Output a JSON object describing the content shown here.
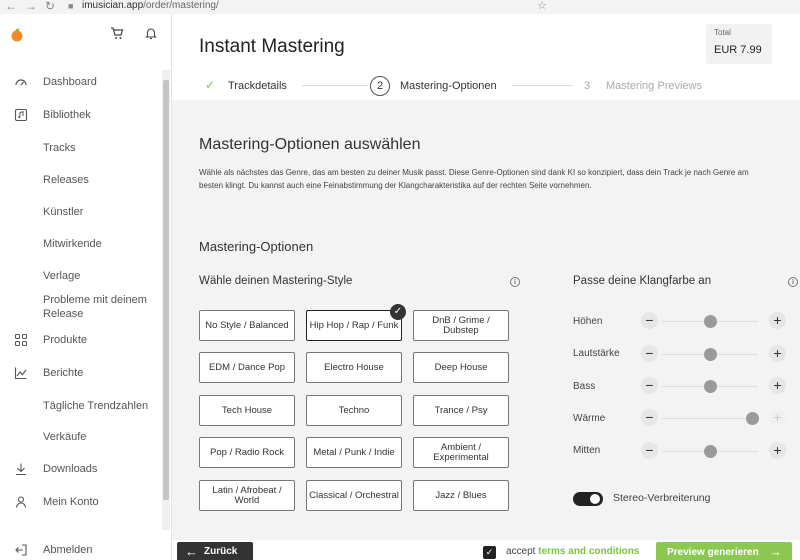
{
  "browser": {
    "url_host": "imusician.app",
    "url_path": "/order/mastering/"
  },
  "sidebar": {
    "items": [
      {
        "label": "Dashboard",
        "icon": "speedometer-icon"
      },
      {
        "label": "Bibliothek",
        "icon": "music-library-icon"
      },
      {
        "label": "Tracks"
      },
      {
        "label": "Releases"
      },
      {
        "label": "Künstler"
      },
      {
        "label": "Mitwirkende"
      },
      {
        "label": "Verlage"
      },
      {
        "label": "Probleme mit deinem Release"
      },
      {
        "label": "Produkte",
        "icon": "grid-icon"
      },
      {
        "label": "Berichte",
        "icon": "chart-line-icon"
      },
      {
        "label": "Tägliche Trendzahlen"
      },
      {
        "label": "Verkäufe"
      },
      {
        "label": "Downloads",
        "icon": "download-icon"
      },
      {
        "label": "Mein Konto",
        "icon": "user-icon"
      }
    ],
    "logout": "Abmelden"
  },
  "header": {
    "title": "Instant Mastering",
    "total_label": "Total",
    "total_value": "EUR 7.99"
  },
  "steps": [
    {
      "label": "Trackdetails",
      "state": "done"
    },
    {
      "num": "2",
      "label": "Mastering-Optionen",
      "state": "active"
    },
    {
      "num": "3",
      "label": "Mastering Previews",
      "state": "pending"
    }
  ],
  "content": {
    "heading": "Mastering-Optionen auswählen",
    "description": "Wähle als nächstes das Genre, das am besten zu deiner Musik passt. Diese Genre-Optionen sind dank KI so konzipiert, dass dein Track je nach Genre am besten klingt. Du kannst auch eine Feinabstimmung der Klangcharakteristika auf der rechten Seite vornehmen.",
    "section_title": "Mastering-Optionen",
    "style_heading": "Wähle deinen Mastering-Style",
    "sound_heading": "Passe deine Klangfarbe an",
    "styles": [
      "No Style / Balanced",
      "Hip Hop / Rap / Funk",
      "DnB / Grime / Dubstep",
      "EDM / Dance Pop",
      "Electro House",
      "Deep House",
      "Tech House",
      "Techno",
      "Trance / Psy",
      "Pop / Radio Rock",
      "Metal / Punk / Indie",
      "Ambient / Experimental",
      "Latin / Afrobeat / World",
      "Classical / Orchestral",
      "Jazz / Blues"
    ],
    "selected_style": "Hip Hop / Rap / Funk",
    "sliders": [
      {
        "label": "Höhen",
        "level": 0.5
      },
      {
        "label": "Lautstärke",
        "level": 0.5
      },
      {
        "label": "Bass",
        "level": 0.5
      },
      {
        "label": "Wärme",
        "level": 1.0
      },
      {
        "label": "Mitten",
        "level": 0.5
      }
    ],
    "stereo_label": "Stereo-Verbreiterung",
    "stereo_on": true
  },
  "footer": {
    "back_label": "Zurück",
    "accept_text": "accept",
    "terms_link": "terms and conditions",
    "preview_label": "Preview generieren"
  },
  "colors": {
    "accent_green": "#8cc751",
    "dark": "#333333"
  }
}
